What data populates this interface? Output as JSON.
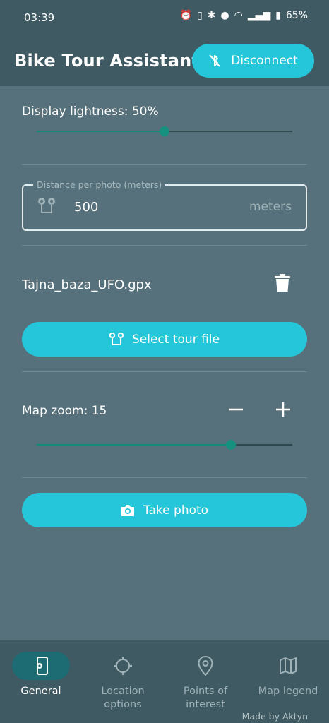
{
  "status_bar": {
    "time": "03:39",
    "battery": "65%",
    "icons": [
      "alarm-icon",
      "vibrate-icon",
      "bluetooth-icon",
      "location-icon",
      "wifi-icon",
      "signal-icon",
      "battery-icon"
    ]
  },
  "app_bar": {
    "title": "Bike Tour Assistant",
    "disconnect_label": "Disconnect"
  },
  "settings": {
    "lightness_label": "Display lightness: 50%",
    "lightness_value": 0.5,
    "distance_field": {
      "legend": "Distance per photo (meters)",
      "value": "500",
      "suffix": "meters"
    },
    "tour_file": "Tajna_baza_UFO.gpx",
    "select_tour_label": "Select tour file",
    "map_zoom_label": "Map zoom: 15",
    "map_zoom_fraction": 0.76,
    "take_photo_label": "Take photo"
  },
  "bottom_nav": {
    "items": [
      {
        "label": "General",
        "icon": "phone-settings-icon",
        "active": true
      },
      {
        "label": "Location options",
        "icon": "crosshair-icon",
        "active": false
      },
      {
        "label": "Points of interest",
        "icon": "map-pin-icon",
        "active": false
      },
      {
        "label": "Map legend",
        "icon": "map-icon",
        "active": false
      }
    ]
  },
  "footer": {
    "made_by": "Made by Aktyn"
  },
  "colors": {
    "background": "#56717b",
    "bars": "#3f5a63",
    "accent": "#26c6da",
    "slider": "#168a7a"
  }
}
